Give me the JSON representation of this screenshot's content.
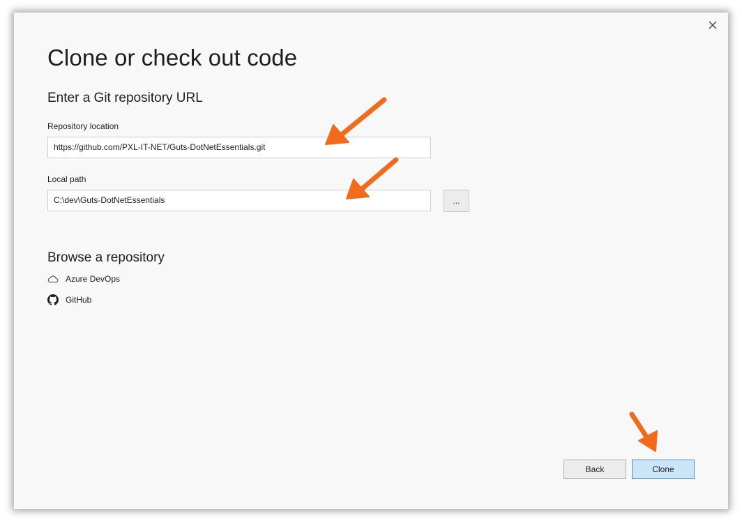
{
  "dialog": {
    "title": "Clone or check out code",
    "close_icon": "close-icon"
  },
  "git_url": {
    "heading": "Enter a Git repository URL",
    "repo_label": "Repository location",
    "repo_value": "https://github.com/PXL-IT-NET/Guts-DotNetEssentials.git",
    "path_label": "Local path",
    "path_value": "C:\\dev\\Guts-DotNetEssentials",
    "browse_label": "..."
  },
  "browse": {
    "heading": "Browse a repository",
    "items": [
      {
        "label": "Azure DevOps",
        "icon": "cloud-icon"
      },
      {
        "label": "GitHub",
        "icon": "github-icon"
      }
    ]
  },
  "footer": {
    "back_label": "Back",
    "clone_label": "Clone"
  },
  "annotations": {
    "arrow_color": "#f26b1d"
  }
}
